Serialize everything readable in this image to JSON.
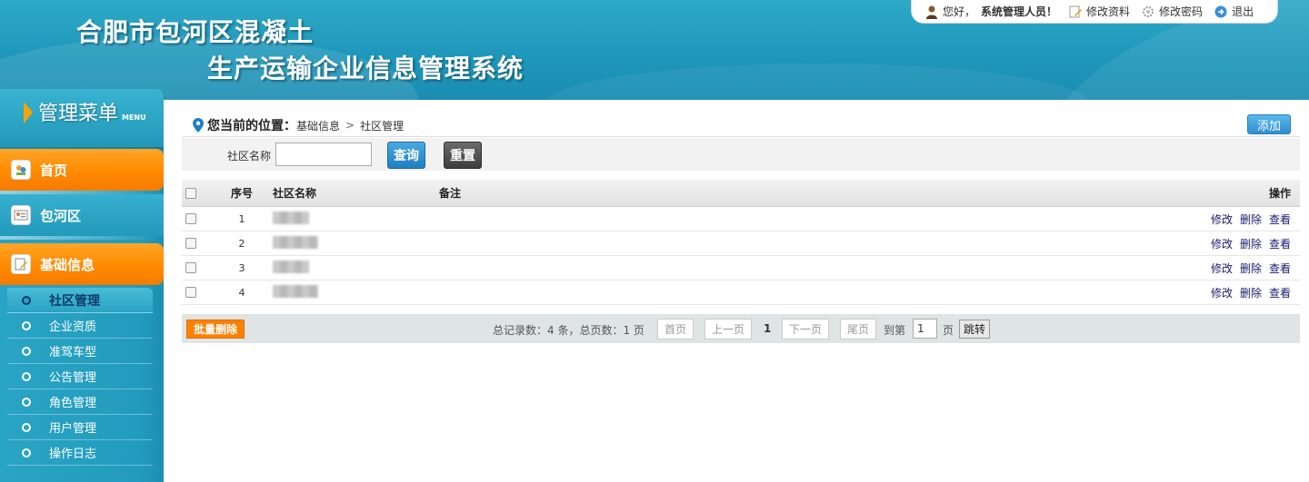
{
  "header": {
    "title_line1": "合肥市包河区混凝土",
    "title_line2": "生产运输企业信息管理系统"
  },
  "userbar": {
    "greeting": "您好，",
    "username": "系统管理人员！",
    "edit_profile": "修改资料",
    "change_password": "修改密码",
    "logout": "退出"
  },
  "sidebar": {
    "menu_title": "管理菜单",
    "menu_en": "MENU",
    "nav": [
      {
        "label": "首页",
        "icon": "home-icon"
      },
      {
        "label": "包河区",
        "icon": "id-card-icon"
      },
      {
        "label": "基础信息",
        "icon": "edit-document-icon"
      }
    ],
    "sub_items": [
      {
        "label": "社区管理",
        "active": true
      },
      {
        "label": "企业资质",
        "active": false
      },
      {
        "label": "准驾车型",
        "active": false
      },
      {
        "label": "公告管理",
        "active": false
      },
      {
        "label": "角色管理",
        "active": false
      },
      {
        "label": "用户管理",
        "active": false
      },
      {
        "label": "操作日志",
        "active": false
      }
    ]
  },
  "main": {
    "location_label": "您当前的位置：",
    "breadcrumb": [
      "基础信息",
      "社区管理"
    ],
    "breadcrumb_sep": ">",
    "add_button": "添加",
    "search": {
      "label": "社区名称",
      "value": "",
      "query_button": "查询",
      "reset_button": "重置"
    },
    "table": {
      "columns": [
        "序号",
        "社区名称",
        "备注",
        "操作"
      ],
      "rows": [
        {
          "seq": "1",
          "name": "",
          "note": ""
        },
        {
          "seq": "2",
          "name": "",
          "note": ""
        },
        {
          "seq": "3",
          "name": "",
          "note": ""
        },
        {
          "seq": "4",
          "name": "",
          "note": ""
        }
      ],
      "actions": [
        "修改",
        "删除",
        "查看"
      ]
    },
    "pager": {
      "batch_delete": "批量删除",
      "total_text": "总记录数：4 条，总页数：1 页",
      "first": "首页",
      "prev": "上一页",
      "current": "1",
      "next": "下一页",
      "last": "尾页",
      "goto_label": "到第",
      "goto_value": "1",
      "page_unit": "页",
      "jump": "跳转"
    }
  },
  "colors": {
    "header_bg": "#1f97bb",
    "sidebar_bg": "#229bbd",
    "nav_orange": "#ff8a00",
    "query_blue": "#1f7fc4",
    "batch_delete_orange": "#ff7f00"
  }
}
